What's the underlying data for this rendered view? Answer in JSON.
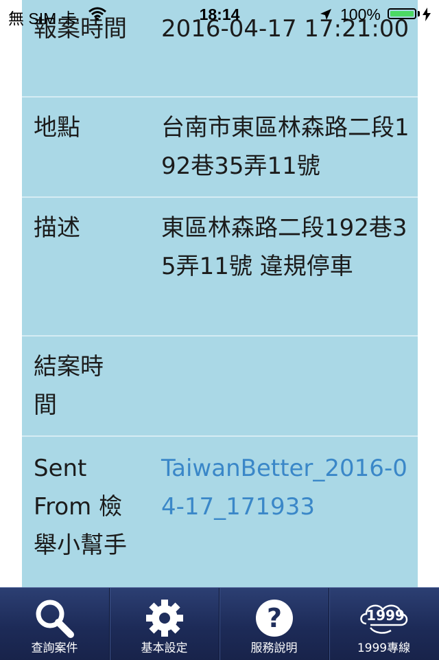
{
  "status_bar": {
    "carrier": "無 SIM 卡",
    "time": "18:14",
    "battery": "100%"
  },
  "rows": [
    {
      "label": "報案時間",
      "value": "2016-04-17 17:21:00"
    },
    {
      "label": "地點",
      "value": "台南市東區林森路二段192巷35弄11號"
    },
    {
      "label": "描述",
      "value": "東區林森路二段192巷35弄11號 違規停車"
    },
    {
      "label": "結案時間",
      "value": ""
    },
    {
      "label": "Sent From 檢舉小幫手",
      "value": "TaiwanBetter_2016-04-17_171933"
    }
  ],
  "tabs": [
    {
      "label": "查詢案件",
      "icon": "search-icon"
    },
    {
      "label": "基本設定",
      "icon": "gear-icon"
    },
    {
      "label": "服務說明",
      "icon": "help-icon"
    },
    {
      "label": "1999專線",
      "icon": "hotline-1999-icon"
    }
  ],
  "colors": {
    "table_bg": "#aad8e6",
    "link": "#3a87c8",
    "tabbar": "#1d2b58",
    "battery": "#4cd964"
  }
}
